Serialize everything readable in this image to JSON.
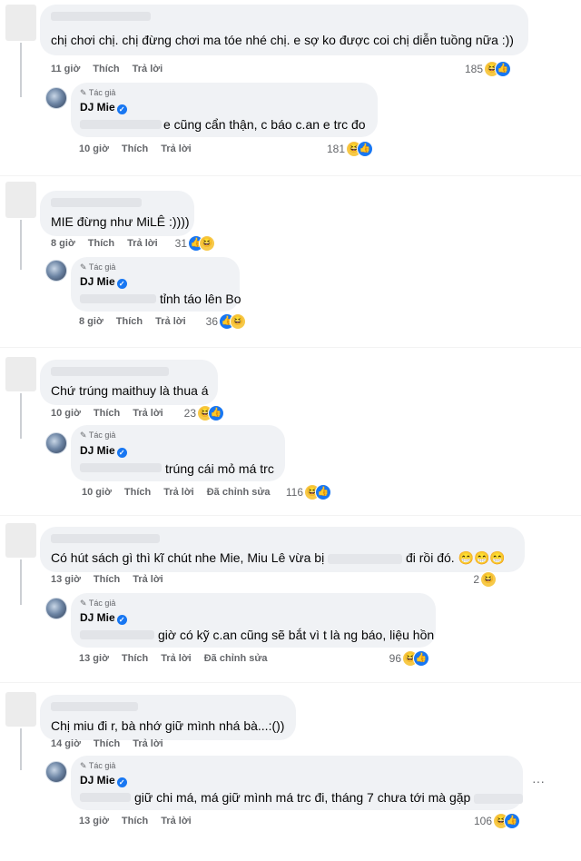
{
  "threads": [
    {
      "comment": {
        "text": "chị chơi chị. chị đừng chơi ma tóe nhé chị. e sợ ko được coi chị diễn tuồng nữa :))",
        "time": "11 giờ",
        "like": "Thích",
        "reply": "Trả lời",
        "count": "185",
        "reactions": [
          "haha",
          "like"
        ]
      },
      "reply": {
        "badge": "Tác giả",
        "name": "DJ Mie",
        "text": "e cũng cẩn thận, c báo c.an e trc đo",
        "time": "10 giờ",
        "like": "Thích",
        "reply": "Trả lời",
        "count": "181",
        "reactions": [
          "haha",
          "like"
        ]
      }
    },
    {
      "comment": {
        "text": "MIE đừng như MiLÊ :))))",
        "time": "8 giờ",
        "like": "Thích",
        "reply": "Trả lời",
        "count": "31",
        "reactions": [
          "like",
          "haha"
        ]
      },
      "reply": {
        "badge": "Tác giả",
        "name": "DJ Mie",
        "text": "tỉnh táo lên Bo",
        "time": "8 giờ",
        "like": "Thích",
        "reply": "Trả lời",
        "count": "36",
        "reactions": [
          "like",
          "haha"
        ]
      }
    },
    {
      "comment": {
        "text": "Chứ trúng maithuy là thua á",
        "time": "10 giờ",
        "like": "Thích",
        "reply": "Trả lời",
        "count": "23",
        "reactions": [
          "haha",
          "like"
        ]
      },
      "reply": {
        "badge": "Tác giả",
        "name": "DJ Mie",
        "text": "trúng cái mỏ má trc",
        "time": "10 giờ",
        "like": "Thích",
        "reply": "Trả lời",
        "edited": "Đã chỉnh sửa",
        "count": "116",
        "reactions": [
          "haha",
          "like"
        ]
      }
    },
    {
      "comment": {
        "text_a": "Có hút sách gì thì kĩ chút nhe Mie, Miu Lê vừa bị",
        "text_b": "đi rồi đó. 😁😁😁",
        "time": "13 giờ",
        "like": "Thích",
        "reply": "Trả lời",
        "count": "2",
        "reactions": [
          "haha"
        ]
      },
      "reply": {
        "badge": "Tác giả",
        "name": "DJ Mie",
        "text": "giờ có kỹ c.an cũng sẽ bắt vì t là ng báo, liệu hồn",
        "time": "13 giờ",
        "like": "Thích",
        "reply": "Trả lời",
        "edited": "Đã chỉnh sửa",
        "count": "96",
        "reactions": [
          "haha",
          "like"
        ]
      }
    },
    {
      "comment": {
        "text": "Chị miu đi r, bà nhớ giữ mình nhá bà...:())",
        "time": "14 giờ",
        "like": "Thích",
        "reply": "Trả lời"
      },
      "reply": {
        "badge": "Tác giả",
        "name": "DJ Mie",
        "text": "giữ chi má, má giữ mình má trc đi, tháng 7 chưa tới mà gặp",
        "time": "13 giờ",
        "like": "Thích",
        "reply": "Trả lời",
        "count": "106",
        "reactions": [
          "haha",
          "like"
        ]
      }
    }
  ],
  "more_label": "···",
  "verified_glyph": "✓",
  "author_glyph": "✎",
  "colors": {
    "bubble": "#f0f2f5",
    "meta": "#65676b",
    "like": "#1877f2",
    "haha": "#f7c948"
  }
}
